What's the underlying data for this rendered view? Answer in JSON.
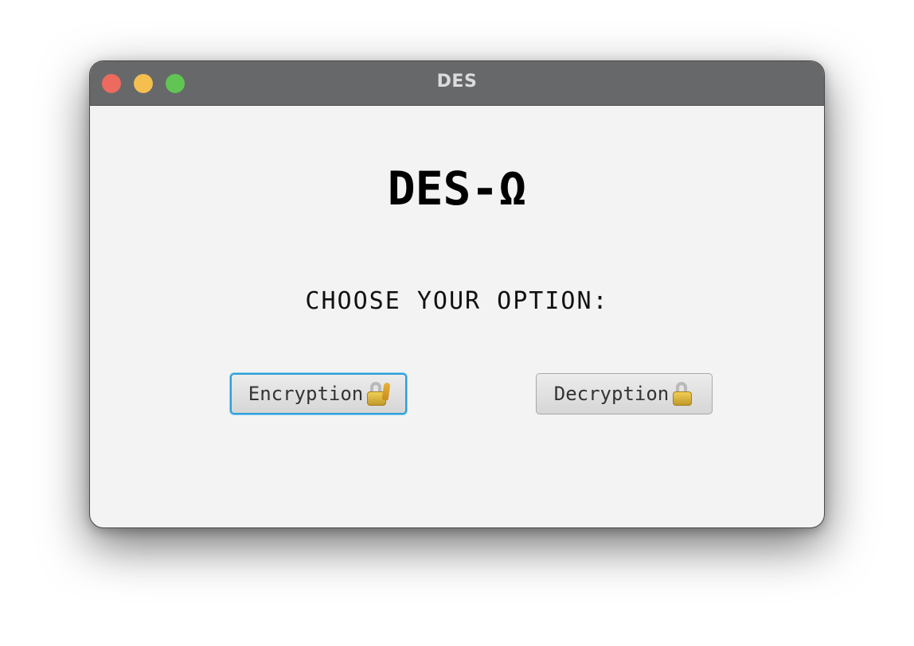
{
  "window": {
    "title": "DES"
  },
  "main": {
    "app_title": "DES-Ω",
    "prompt": "CHOOSE YOUR OPTION:",
    "buttons": {
      "encryption_label": "Encryption",
      "encryption_icon": "locked-with-key-icon",
      "decryption_label": "Decryption",
      "decryption_icon": "lock-icon"
    }
  },
  "colors": {
    "titlebar": "#67686a",
    "close": "#ec6a5e",
    "minimize": "#f4bf4f",
    "maximize": "#61c554",
    "focus_ring": "#2a9fd8",
    "content_bg": "#f3f3f3"
  }
}
